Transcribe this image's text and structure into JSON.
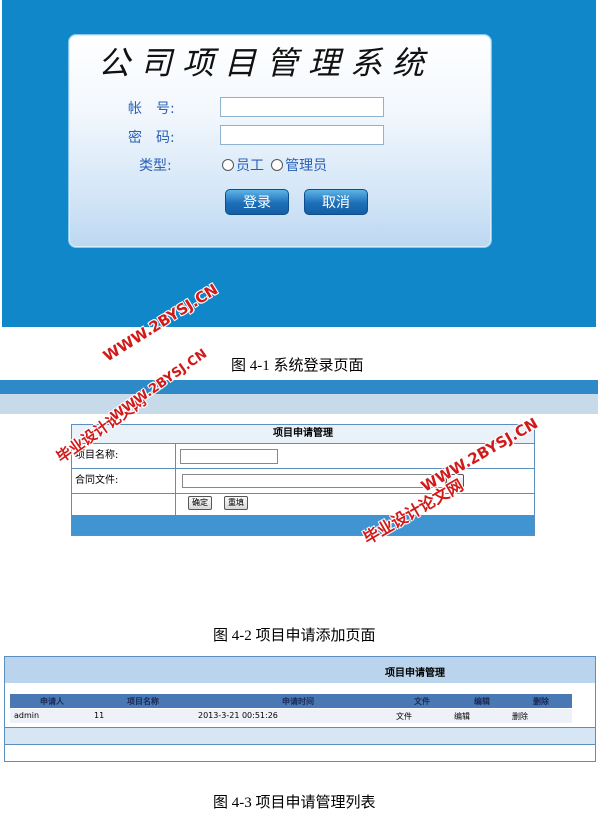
{
  "figure1": {
    "system_title": "公司项目管理系统",
    "account_label": "帐　号:",
    "password_label": "密　码:",
    "type_label": "类型:",
    "option_employee": "员工",
    "option_admin": "管理员",
    "login_button": "登录",
    "cancel_button": "取消",
    "caption": "图 4-1 系统登录页面"
  },
  "figure2": {
    "table_title": "项目申请管理",
    "project_name_label": "项目名称:",
    "contract_file_label": "合同文件:",
    "confirm_button": "确定",
    "reset_button": "重填",
    "caption": "图 4-2 项目申请添加页面"
  },
  "figure3": {
    "table_title": "项目申请管理",
    "columns": [
      "申请人",
      "项目名称",
      "申请时间",
      "文件",
      "编辑",
      "删除"
    ],
    "rows": [
      [
        "admin",
        "11",
        "2013-3-21 00:51:26",
        "文件",
        "编辑",
        "删除"
      ]
    ],
    "caption": "图 4-3 项目申请管理列表"
  },
  "watermarks": {
    "site_cn": "毕业设计论文网",
    "site_url": "WWW.2BYSJ.CN"
  },
  "colors": {
    "login_bg": "#0f87c9",
    "button_blue": "#1d6fb8",
    "label_blue": "#2a5fb8",
    "watermark_red": "#d21a1a"
  }
}
